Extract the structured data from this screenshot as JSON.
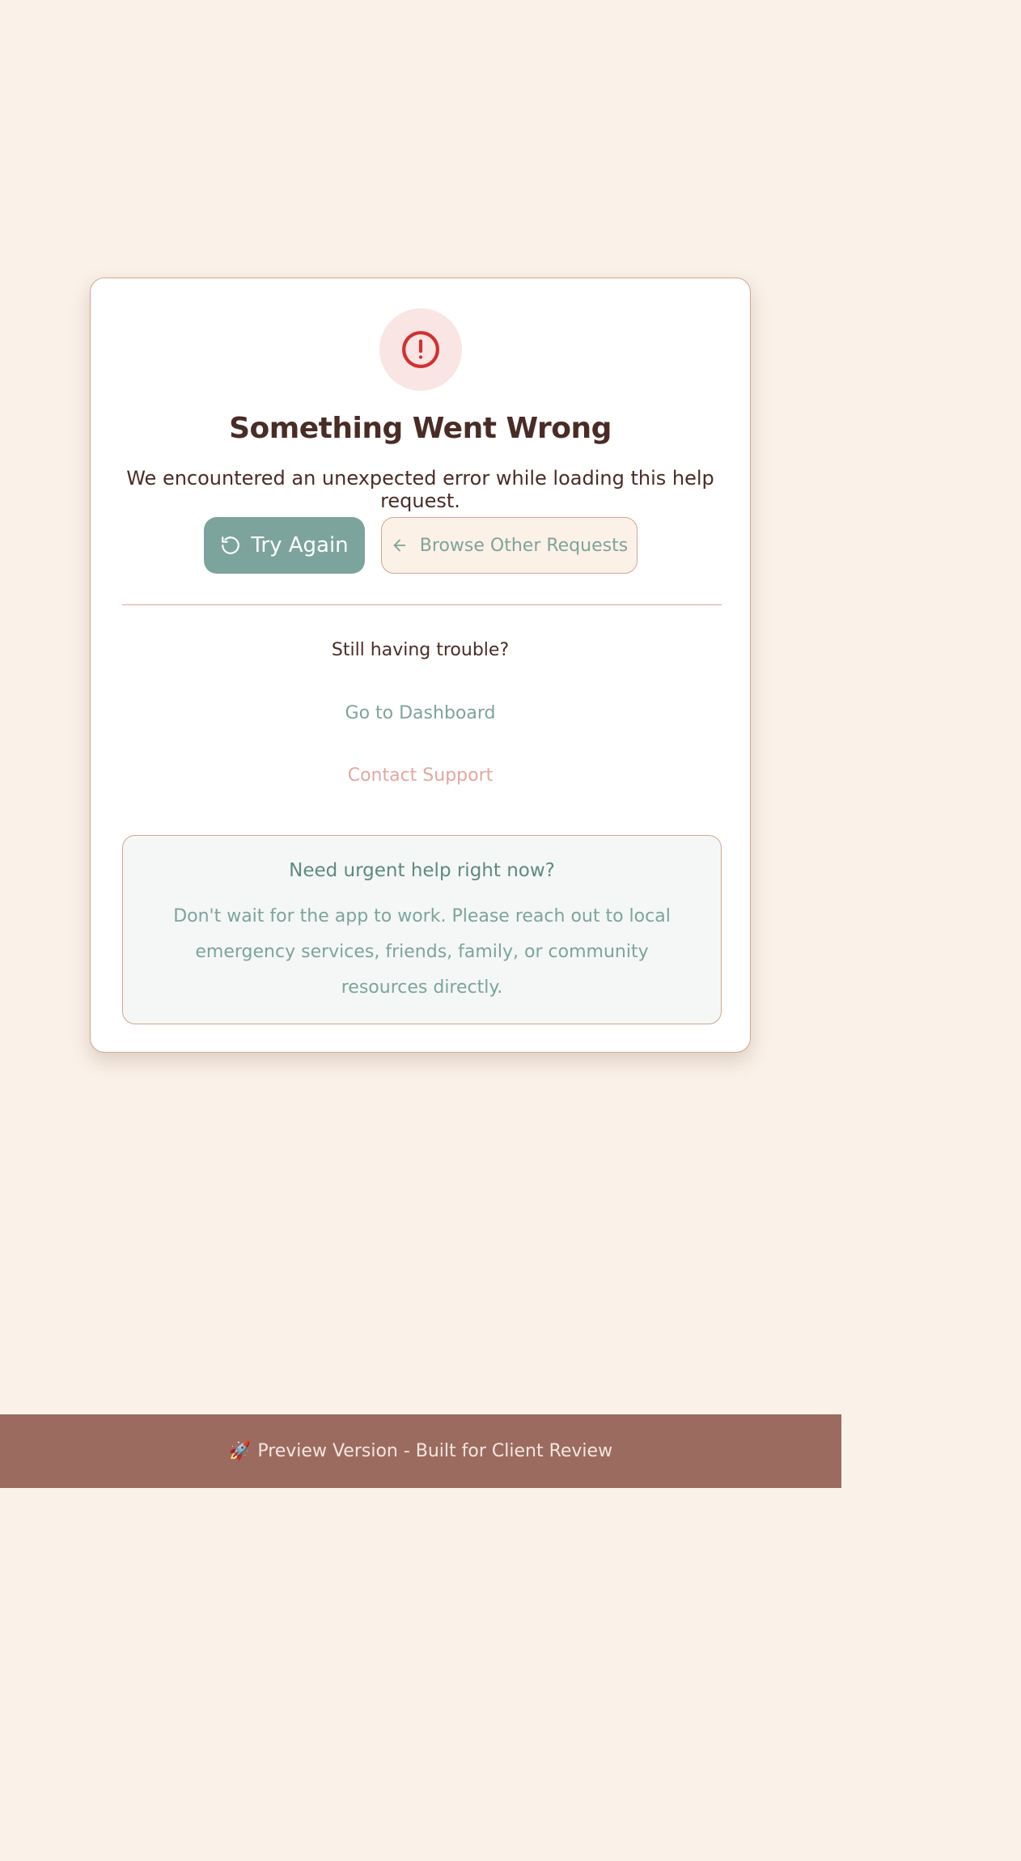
{
  "error_card": {
    "title": "Something Went Wrong",
    "message": "We encountered an unexpected error while loading this help request.",
    "try_again_label": "Try Again",
    "browse_label": "Browse Other Requests",
    "trouble_text": "Still having trouble?",
    "dashboard_link": "Go to Dashboard",
    "support_link": "Contact Support",
    "urgent": {
      "title": "Need urgent help right now?",
      "text": "Don't wait for the app to work. Please reach out to local emergency services, friends, family, or community resources directly."
    }
  },
  "footer": {
    "text": "Preview Version - Built for Client Review"
  },
  "icons": {
    "alert": "alert-circle-icon",
    "retry": "refresh-icon",
    "back": "arrow-left-icon",
    "footer": "rocket-icon"
  },
  "colors": {
    "background": "#faf1e8",
    "primary": "#7da49c",
    "error": "#d32f2f",
    "error_bg": "#f9e5e3",
    "accent": "#e3a7a0",
    "border": "#d4a590",
    "footer_bg": "#9c6b60",
    "text": "#4a2c26"
  }
}
